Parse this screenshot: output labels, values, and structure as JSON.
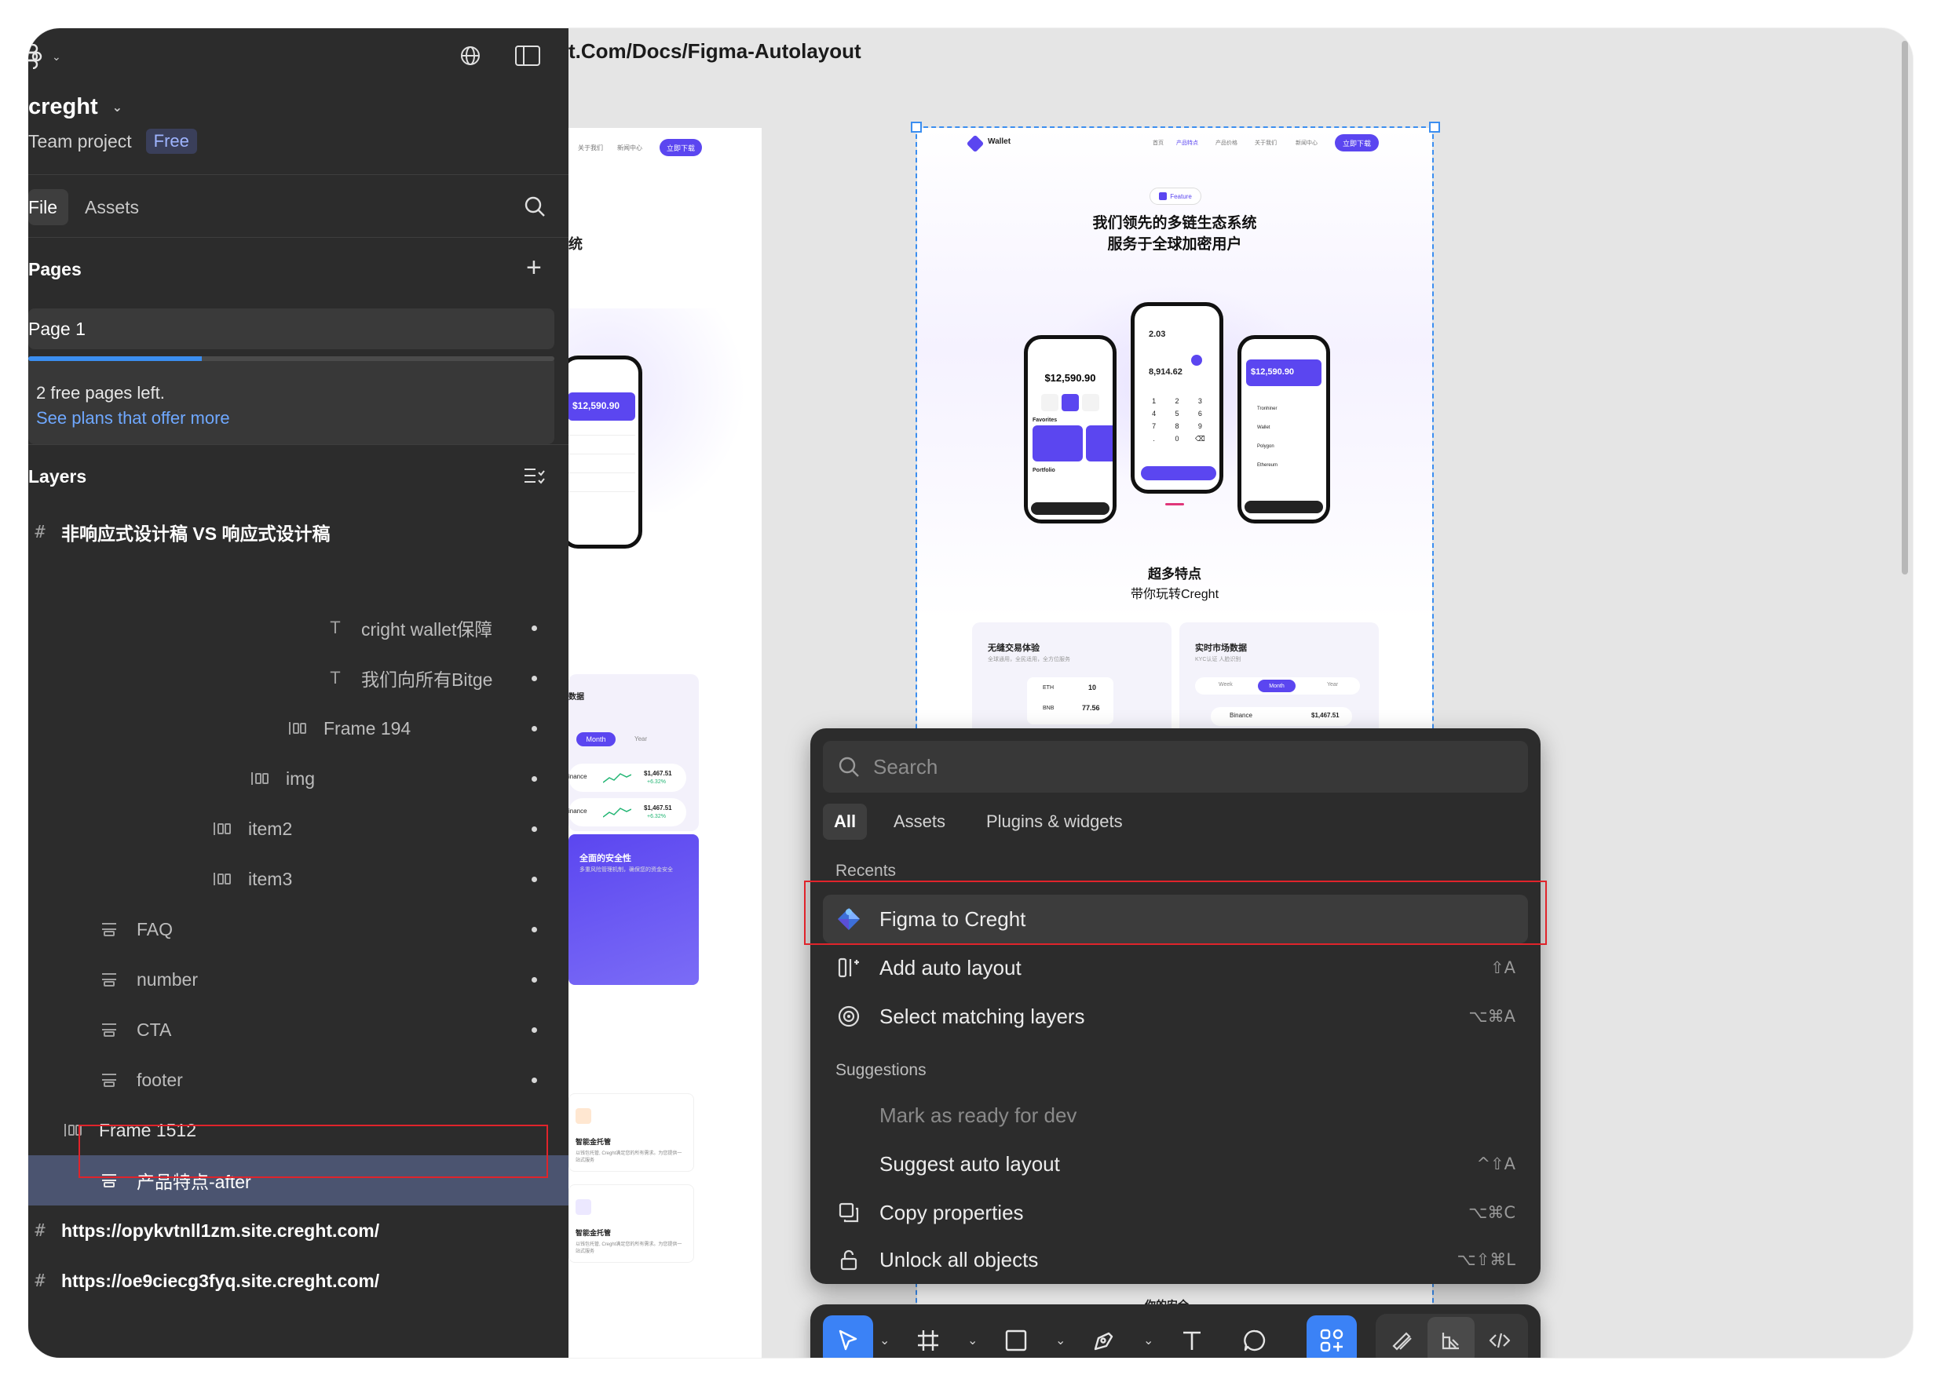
{
  "sidebar": {
    "project_name": "creght",
    "team_label": "Team project",
    "plan_badge": "Free",
    "tabs": {
      "file": "File",
      "assets": "Assets"
    },
    "pages_label": "Pages",
    "page_item": "Page 1",
    "upsell": {
      "text": "2 free pages left.",
      "link": "See plans that offer more",
      "progress": 0.33
    },
    "layers_label": "Layers",
    "layers": [
      {
        "name": "非响应式设计稿 VS 响应式设计稿",
        "type": "frame-hash"
      },
      {
        "name": "cright wallet保障",
        "type": "text"
      },
      {
        "name": "我们向所有Bitge",
        "type": "text"
      },
      {
        "name": "Frame 194",
        "type": "autolayout"
      },
      {
        "name": "img",
        "type": "autolayout"
      },
      {
        "name": "item2",
        "type": "autolayout"
      },
      {
        "name": "item3",
        "type": "autolayout"
      },
      {
        "name": "FAQ",
        "type": "section"
      },
      {
        "name": "number",
        "type": "section"
      },
      {
        "name": "CTA",
        "type": "section"
      },
      {
        "name": "footer",
        "type": "section"
      },
      {
        "name": "Frame 1512",
        "type": "autolayout"
      },
      {
        "name": "产品特点-after",
        "type": "section",
        "selected": true
      },
      {
        "name": "https://opykvtnll1zm.site.creght.com/",
        "type": "frame-hash"
      },
      {
        "name": "https://oe9ciecg3fyq.site.creght.com/",
        "type": "frame-hash"
      }
    ]
  },
  "canvas": {
    "url_title": "t.Com/Docs/Figma-Autolayout",
    "left_frame": {
      "nav": [
        "关于我们",
        "新闻中心"
      ],
      "cta": "立即下载",
      "heading_fragment": "统",
      "balance": "$12,590.90",
      "section_fragment": "数据",
      "tabs": [
        "Month",
        "Year"
      ],
      "rows": [
        {
          "name": "inance",
          "value": "$1,467.51",
          "change": "+6.32%"
        },
        {
          "name": "inance",
          "value": "$1,467.51",
          "change": "+6.32%"
        }
      ],
      "security_title": "全面的安全性",
      "security_desc": "多重风险管理机制，确保您的资金安全",
      "features": [
        {
          "title": "智能金托管",
          "desc": "以钱包托管, Creght满足您的所有需求。为您提供一站式服务"
        },
        {
          "title": "智能金托管",
          "desc": "以钱包托管, Creght满足您的所有需求。为您提供一站式服务"
        }
      ]
    },
    "right_frame": {
      "brand": "Wallet",
      "nav": [
        "首页",
        "产品特点",
        "产品价格",
        "关于我们",
        "新闻中心"
      ],
      "cta": "立即下载",
      "badge": "Feature",
      "headline": [
        "我们领先的多链生态系统",
        "服务于全球加密用户"
      ],
      "phones": [
        {
          "balance": "$12,590.90",
          "list_label": "Favorites",
          "list_label2": "Portfolio"
        },
        {
          "top": "2.03",
          "value": "8,914.62",
          "keys": [
            "1",
            "2",
            "3",
            "4",
            "5",
            "6",
            "7",
            "8",
            "9",
            ".",
            "0",
            "⌫"
          ]
        },
        {
          "balance": "$12,590.90",
          "coins": [
            "Tronhiner",
            "Wallet",
            "Polygon",
            "Ethereum"
          ]
        }
      ],
      "section_title": [
        "超多特点",
        "带你玩转Creght"
      ],
      "cards": [
        {
          "title": "无缝交易体验",
          "desc": "全球通用，全民适用，全方位服务",
          "rows": [
            {
              "coin": "ETH",
              "value": "10"
            },
            {
              "coin": "BNB",
              "value": "77.56"
            }
          ]
        },
        {
          "title": "实时市场数据",
          "desc": "KYC认证 人脸识别",
          "tabs": [
            "Week",
            "Month",
            "Year"
          ],
          "row": {
            "coin": "Binance",
            "value": "$1,467.51"
          }
        }
      ],
      "bottom_fragment": "你的安全"
    }
  },
  "quick_actions": {
    "search_placeholder": "Search",
    "tabs": [
      "All",
      "Assets",
      "Plugins & widgets"
    ],
    "recents_label": "Recents",
    "recents": [
      {
        "label": "Figma to Creght",
        "icon": "creght-logo-icon",
        "shortcut": ""
      },
      {
        "label": "Add auto layout",
        "icon": "auto-layout-icon",
        "shortcut": "⇧A"
      },
      {
        "label": "Select matching layers",
        "icon": "target-icon",
        "shortcut": "⌥⌘A"
      }
    ],
    "suggestions_label": "Suggestions",
    "suggestions": [
      {
        "label": "Mark as ready for dev",
        "icon": "",
        "shortcut": "",
        "disabled": true
      },
      {
        "label": "Suggest auto layout",
        "icon": "",
        "shortcut": "^⇧A"
      },
      {
        "label": "Copy properties",
        "icon": "copy-icon",
        "shortcut": "⌥⌘C"
      },
      {
        "label": "Unlock all objects",
        "icon": "lock-icon",
        "shortcut": "⌥⇧⌘L"
      }
    ]
  },
  "toolbar": {
    "tools": [
      "move",
      "frame",
      "shape",
      "pen",
      "text",
      "comment",
      "actions"
    ],
    "right_tools": [
      "draw",
      "design",
      "dev"
    ]
  },
  "colors": {
    "accent": "#3b82f6",
    "brand_purple": "#5b46f0",
    "highlight_red": "#e0242b"
  }
}
